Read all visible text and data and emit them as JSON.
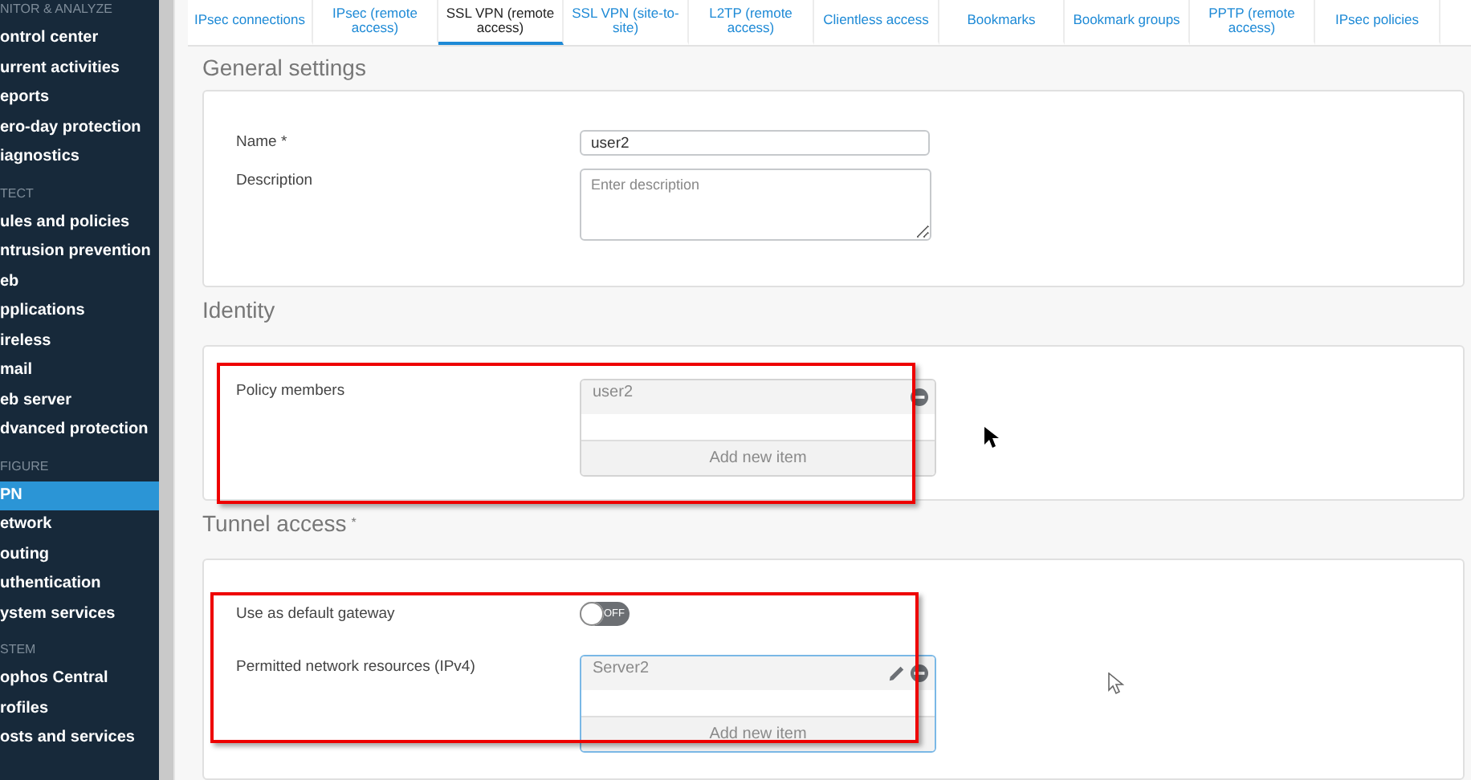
{
  "sidebar": {
    "groups": [
      {
        "header": "NITOR & ANALYZE",
        "items": [
          {
            "label": "ontrol center",
            "selected": false
          },
          {
            "label": "urrent activities",
            "selected": false
          },
          {
            "label": "eports",
            "selected": false
          },
          {
            "label": "ero-day protection",
            "selected": false
          },
          {
            "label": "iagnostics",
            "selected": false
          }
        ]
      },
      {
        "header": "TECT",
        "items": [
          {
            "label": "ules and policies",
            "selected": false
          },
          {
            "label": "ntrusion prevention",
            "selected": false
          },
          {
            "label": "eb",
            "selected": false
          },
          {
            "label": "pplications",
            "selected": false
          },
          {
            "label": "ireless",
            "selected": false
          },
          {
            "label": "mail",
            "selected": false
          },
          {
            "label": "eb server",
            "selected": false
          },
          {
            "label": "dvanced protection",
            "selected": false
          }
        ]
      },
      {
        "header": "FIGURE",
        "items": [
          {
            "label": "PN",
            "selected": true
          },
          {
            "label": "etwork",
            "selected": false
          },
          {
            "label": "outing",
            "selected": false
          },
          {
            "label": "uthentication",
            "selected": false
          },
          {
            "label": "ystem services",
            "selected": false
          }
        ]
      },
      {
        "header": "STEM",
        "items": [
          {
            "label": "ophos Central",
            "selected": false
          },
          {
            "label": "rofiles",
            "selected": false
          },
          {
            "label": "osts and services",
            "selected": false
          }
        ]
      }
    ]
  },
  "tabs": [
    {
      "label": "IPsec connections",
      "selected": false
    },
    {
      "label": "IPsec (remote access)",
      "selected": false
    },
    {
      "label": "SSL VPN (remote access)",
      "selected": true
    },
    {
      "label": "SSL VPN (site-to-site)",
      "selected": false
    },
    {
      "label": "L2TP (remote access)",
      "selected": false
    },
    {
      "label": "Clientless access",
      "selected": false
    },
    {
      "label": "Bookmarks",
      "selected": false
    },
    {
      "label": "Bookmark groups",
      "selected": false
    },
    {
      "label": "PPTP (remote access)",
      "selected": false
    },
    {
      "label": "IPsec policies",
      "selected": false
    }
  ],
  "sections": [
    {
      "title": "General settings",
      "fields": [
        {
          "kind": "text",
          "label": "Name *",
          "value": "user2"
        },
        {
          "kind": "textarea",
          "label": "Description",
          "placeholder": "Enter description"
        }
      ]
    },
    {
      "title": "Identity",
      "highlighted": true,
      "fields": [
        {
          "kind": "list",
          "label": "Policy members",
          "focused": false,
          "items": [
            {
              "label": "user2",
              "editable": false
            }
          ],
          "add_label": "Add new item"
        }
      ]
    },
    {
      "title": "Tunnel access",
      "required_mark": "*",
      "highlighted": true,
      "fields": [
        {
          "kind": "toggle",
          "label": "Use as default gateway",
          "on": false,
          "state_label": "OFF"
        },
        {
          "kind": "list",
          "label": "Permitted network resources (IPv4)",
          "focused": true,
          "items": [
            {
              "label": "Server2",
              "editable": true
            }
          ],
          "add_label": "Add new item"
        }
      ]
    }
  ]
}
